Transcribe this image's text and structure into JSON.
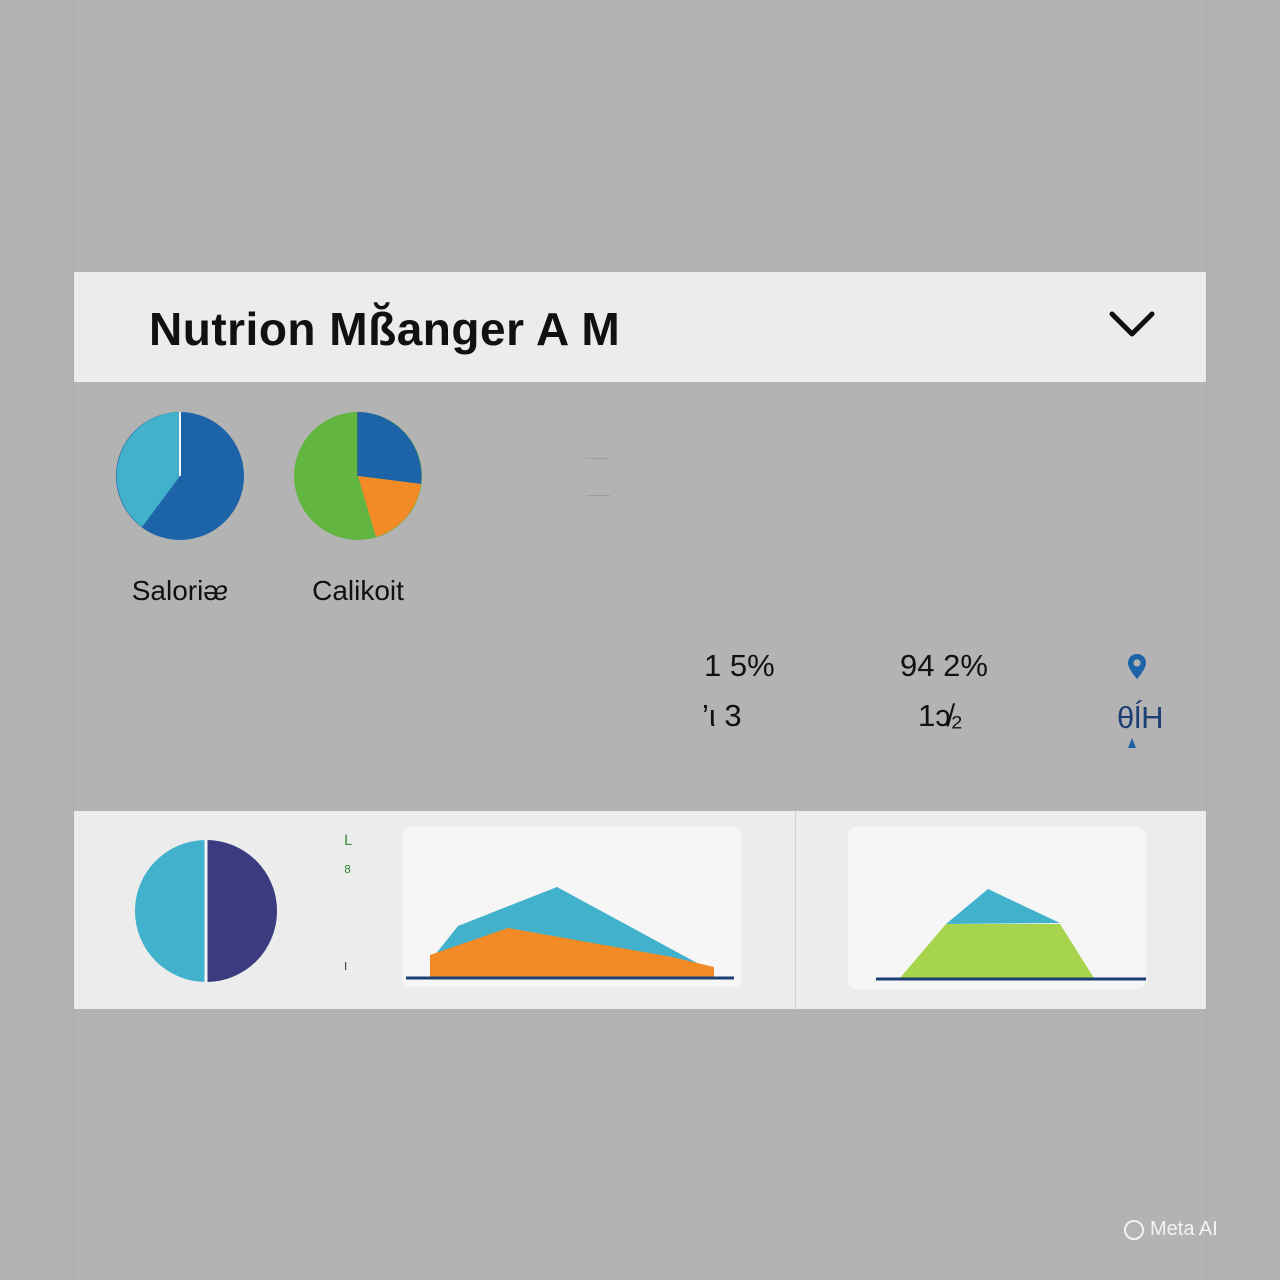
{
  "header": {
    "title": "Nutrion Mß̆anger A M"
  },
  "colors": {
    "light_blue": "#42b1cc",
    "dark_blue": "#1d63a8",
    "green": "#63b541",
    "orange": "#f28a26",
    "indigo": "#3d3b80",
    "lime": "#a6d44d",
    "axis": "#1c3f74"
  },
  "pies": [
    {
      "label": "Saloriᴂ"
    },
    {
      "label": "Calikoit"
    }
  ],
  "stats": {
    "col1_top": "1 5%",
    "col1_bottom": "’ι 3",
    "col2_top": "94 2%",
    "col2_bottom": "1ɔ̸₂",
    "col3_bottom": "θĺH"
  },
  "bottom_panel": {
    "tick_top": "L",
    "tick_mid": "8",
    "tick_low": "I"
  },
  "icons": {
    "header_toggle": "chevron-down-icon",
    "location": "map-pin-icon",
    "caret": "caret-up-icon"
  },
  "watermark": "Meta AI"
}
